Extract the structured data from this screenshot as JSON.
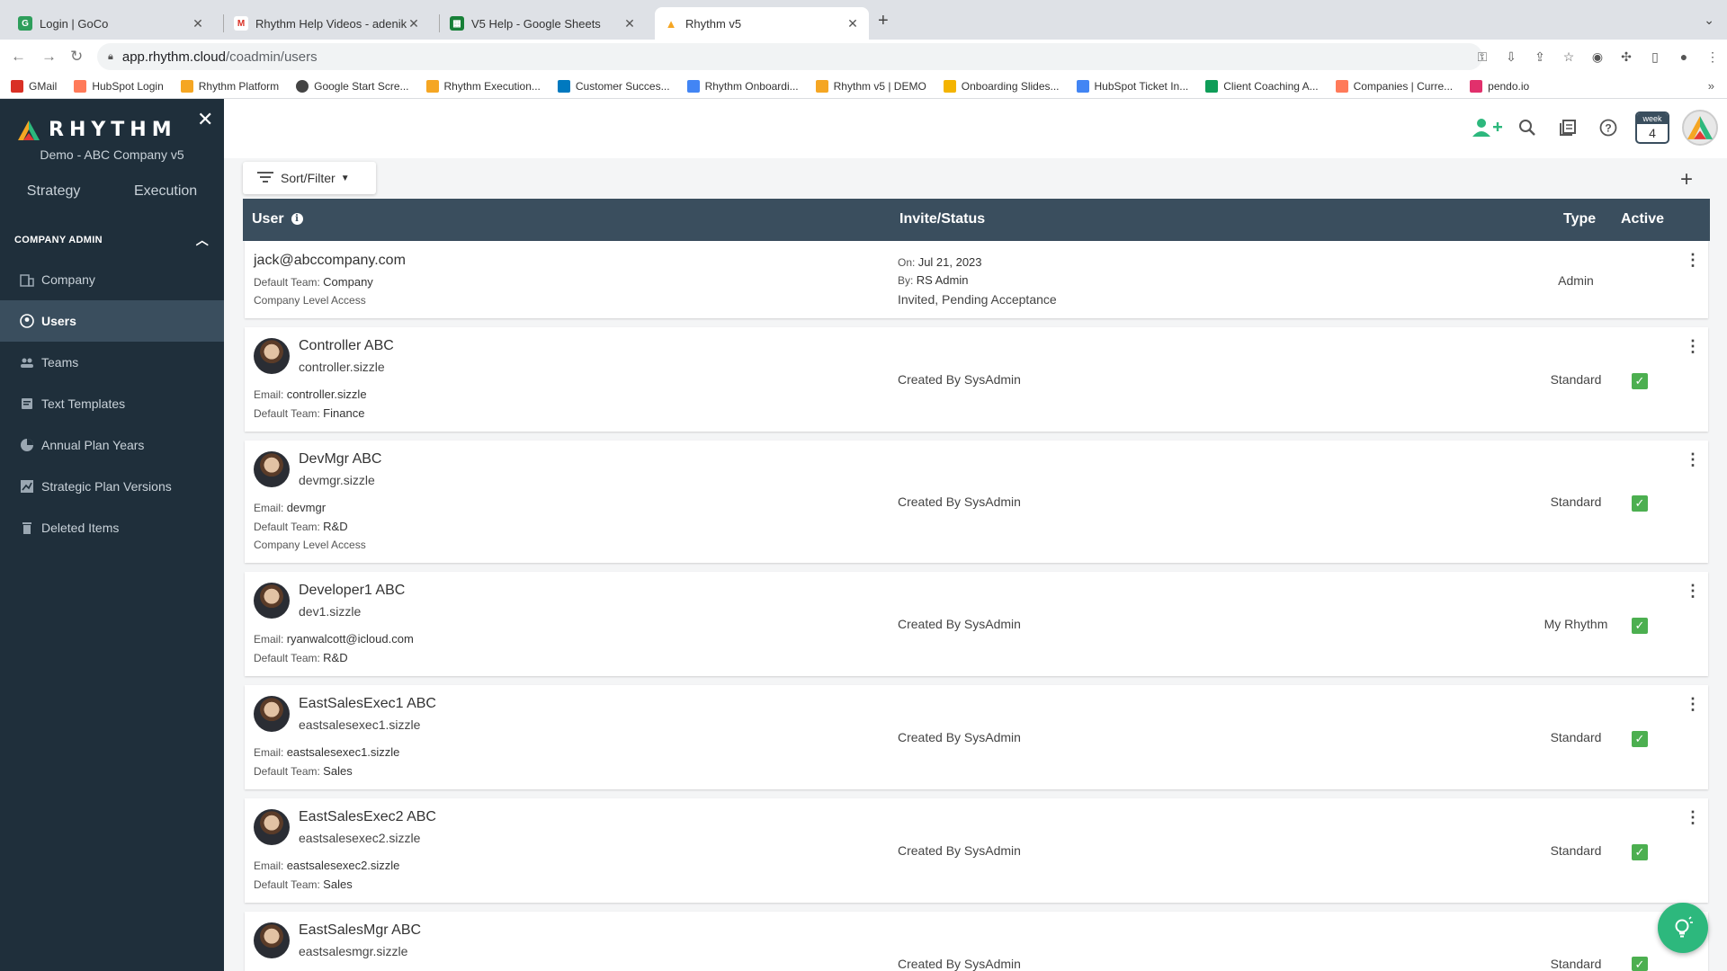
{
  "browser": {
    "tabs": [
      {
        "title": "Login | GoCo",
        "icon": "goco-favicon",
        "color": "#2e9e5b"
      },
      {
        "title": "Rhythm Help Videos - adenike",
        "icon": "gmail-favicon",
        "color": "#d93025"
      },
      {
        "title": "V5 Help - Google Sheets",
        "icon": "sheets-favicon",
        "color": "#188038"
      },
      {
        "title": "Rhythm v5",
        "icon": "rhythm-favicon",
        "color": "#f5a623"
      }
    ],
    "url_host": "app.rhythm.cloud",
    "url_path": "/coadmin/users",
    "bookmarks": [
      {
        "label": "GMail",
        "color": "#d93025"
      },
      {
        "label": "HubSpot Login",
        "color": "#ff7a59"
      },
      {
        "label": "Rhythm Platform",
        "color": "#f5a623"
      },
      {
        "label": "Google Start Scre...",
        "color": "#444444"
      },
      {
        "label": "Rhythm Execution...",
        "color": "#f5a623"
      },
      {
        "label": "Customer Succes...",
        "color": "#0079bf"
      },
      {
        "label": "Rhythm Onboardi...",
        "color": "#4285f4"
      },
      {
        "label": "Rhythm v5 | DEMO",
        "color": "#f5a623"
      },
      {
        "label": "Onboarding Slides...",
        "color": "#f4b400"
      },
      {
        "label": "HubSpot Ticket In...",
        "color": "#4285f4"
      },
      {
        "label": "Client Coaching A...",
        "color": "#0f9d58"
      },
      {
        "label": "Companies | Curre...",
        "color": "#ff7a59"
      },
      {
        "label": "pendo.io",
        "color": "#e1306c"
      }
    ]
  },
  "sidebar": {
    "logo_text": "RHYTHM",
    "company": "Demo - ABC Company v5",
    "modes": [
      "Strategy",
      "Execution"
    ],
    "section": "COMPANY ADMIN",
    "items": [
      {
        "label": "Company",
        "icon": "building-icon"
      },
      {
        "label": "Users",
        "icon": "user-circle-icon"
      },
      {
        "label": "Teams",
        "icon": "people-icon"
      },
      {
        "label": "Text Templates",
        "icon": "template-icon"
      },
      {
        "label": "Annual Plan Years",
        "icon": "pie-chart-icon"
      },
      {
        "label": "Strategic Plan Versions",
        "icon": "chart-icon"
      },
      {
        "label": "Deleted Items",
        "icon": "trash-icon"
      }
    ]
  },
  "header": {
    "week_label": "week",
    "week_number": "4"
  },
  "toolbar": {
    "sort_filter": "Sort/Filter"
  },
  "table": {
    "headers": {
      "user": "User",
      "status": "Invite/Status",
      "type": "Type",
      "active": "Active"
    },
    "invite_row": {
      "email": "jack@abccompany.com",
      "team_label": "Default Team:",
      "team": "Company",
      "access": "Company Level Access",
      "on_label": "On:",
      "on_date": "Jul 21, 2023",
      "by_label": "By:",
      "by": "RS Admin",
      "status": "Invited, Pending Acceptance",
      "type": "Admin"
    },
    "rows": [
      {
        "name": "Controller ABC",
        "handle": "controller.sizzle",
        "email_label": "Email:",
        "email": "controller.sizzle",
        "team_label": "Default Team:",
        "team": "Finance",
        "access": "",
        "status": "Created By SysAdmin",
        "type": "Standard",
        "active": true
      },
      {
        "name": "DevMgr ABC",
        "handle": "devmgr.sizzle",
        "email_label": "Email:",
        "email": "devmgr",
        "team_label": "Default Team:",
        "team": "R&D",
        "access": "Company Level Access",
        "status": "Created By SysAdmin",
        "type": "Standard",
        "active": true
      },
      {
        "name": "Developer1 ABC",
        "handle": "dev1.sizzle",
        "email_label": "Email:",
        "email": "ryanwalcott@icloud.com",
        "team_label": "Default Team:",
        "team": "R&D",
        "access": "",
        "status": "Created By SysAdmin",
        "type": "My Rhythm",
        "active": true
      },
      {
        "name": "EastSalesExec1 ABC",
        "handle": "eastsalesexec1.sizzle",
        "email_label": "Email:",
        "email": "eastsalesexec1.sizzle",
        "team_label": "Default Team:",
        "team": "Sales",
        "access": "",
        "status": "Created By SysAdmin",
        "type": "Standard",
        "active": true
      },
      {
        "name": "EastSalesExec2 ABC",
        "handle": "eastsalesexec2.sizzle",
        "email_label": "Email:",
        "email": "eastsalesexec2.sizzle",
        "team_label": "Default Team:",
        "team": "Sales",
        "access": "",
        "status": "Created By SysAdmin",
        "type": "Standard",
        "active": true
      },
      {
        "name": "EastSalesMgr ABC",
        "handle": "eastsalesmgr.sizzle",
        "email_label": "",
        "email": "",
        "team_label": "",
        "team": "",
        "access": "",
        "status": "Created By SysAdmin",
        "type": "Standard",
        "active": true
      }
    ]
  },
  "colors": {
    "sidebar": "#1f2f3b",
    "header_bar": "#3a4e5e",
    "active_check": "#4caf50",
    "fab": "#2db87d"
  }
}
